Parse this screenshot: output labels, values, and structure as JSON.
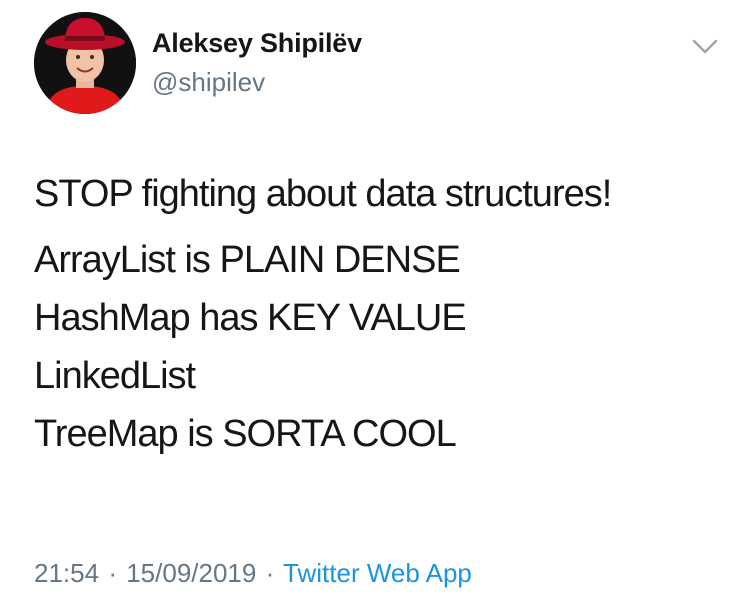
{
  "author": {
    "display_name": "Aleksey Shipilëv",
    "handle": "@shipilev"
  },
  "header": {
    "menu_icon": "chevron-down-icon"
  },
  "tweet": {
    "lines": [
      "STOP fighting about data structures!",
      "ArrayList is PLAIN DENSE",
      "HashMap has KEY VALUE",
      "LinkedList",
      "TreeMap is SORTA COOL"
    ]
  },
  "meta": {
    "time": "21:54",
    "separator_1": "·",
    "date": "15/09/2019",
    "separator_2": "·",
    "source": "Twitter Web App"
  },
  "colors": {
    "text": "#14171a",
    "secondary": "#657786",
    "link": "#1b95e0",
    "avatar_hat": "#c8102e",
    "avatar_shirt": "#e01a1a"
  }
}
